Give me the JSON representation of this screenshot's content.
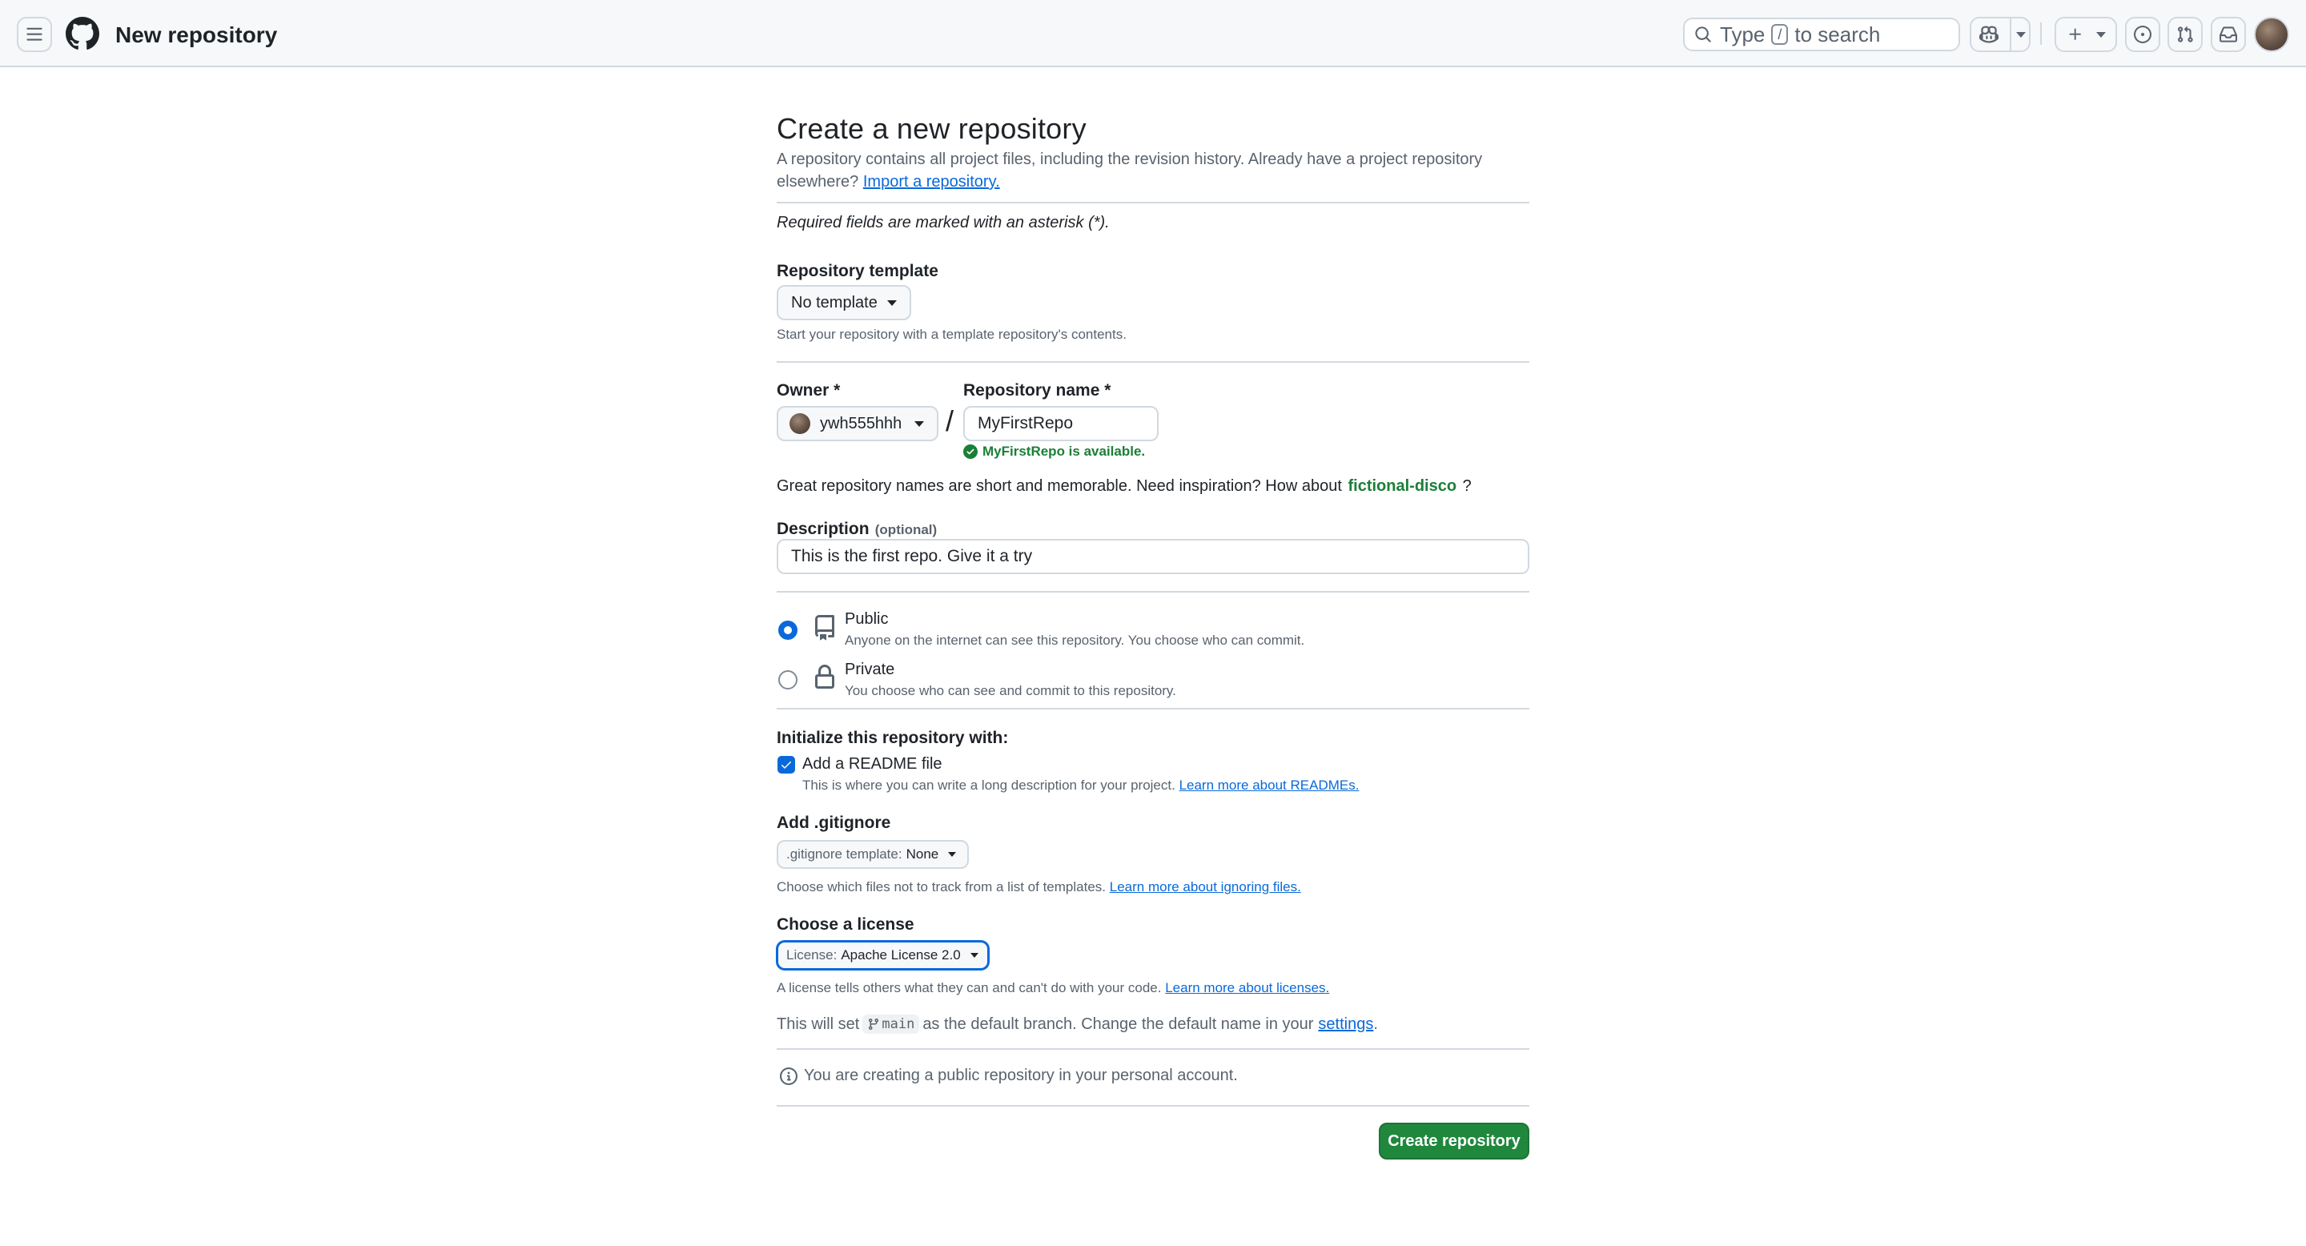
{
  "header": {
    "page_name": "New repository",
    "search_prefix": "Type",
    "search_key": "/",
    "search_suffix": "to search"
  },
  "main": {
    "title": "Create a new repository",
    "intro_line1": "A repository contains all project files, including the revision history. Already have a project repository",
    "intro_line2_prefix": "elsewhere?",
    "import_link": "Import a repository.",
    "required_note": "Required fields are marked with an asterisk (*).",
    "template": {
      "label": "Repository template",
      "button": "No template",
      "help": "Start your repository with a template repository's contents."
    },
    "owner": {
      "label": "Owner *",
      "value": "ywh555hhh"
    },
    "slash": "/",
    "repo_name": {
      "label": "Repository name *",
      "value": "MyFirstRepo",
      "availability": "MyFirstRepo is available."
    },
    "suggestion": {
      "prefix": "Great repository names are short and memorable. Need inspiration? How about",
      "name": "fictional-disco",
      "suffix": "?"
    },
    "description": {
      "label": "Description",
      "optional": "(optional)",
      "value": "This is the first repo. Give it a try"
    },
    "visibility": {
      "public_label": "Public",
      "public_desc": "Anyone on the internet can see this repository. You choose who can commit.",
      "private_label": "Private",
      "private_desc": "You choose who can see and commit to this repository."
    },
    "init": {
      "heading": "Initialize this repository with:",
      "readme_label": "Add a README file",
      "readme_desc": "This is where you can write a long description for your project.",
      "readme_link": "Learn more about READMEs."
    },
    "gitignore": {
      "heading": "Add .gitignore",
      "button_prefix": ".gitignore template:",
      "button_value": "None",
      "help": "Choose which files not to track from a list of templates.",
      "help_link": "Learn more about ignoring files."
    },
    "license": {
      "heading": "Choose a license",
      "button_prefix": "License:",
      "button_value": "Apache License 2.0",
      "help": "A license tells others what they can and can't do with your code.",
      "help_link": "Learn more about licenses."
    },
    "branch": {
      "prefix": "This will set",
      "branch_name": "main",
      "middle": "as the default branch. Change the default name in your",
      "settings_link": "settings",
      "suffix": "."
    },
    "notice": "You are creating a public repository in your personal account.",
    "submit": "Create repository"
  },
  "colors": {
    "accent": "#0969da",
    "success": "#1a7f37",
    "primary_button": "#1f883d"
  }
}
